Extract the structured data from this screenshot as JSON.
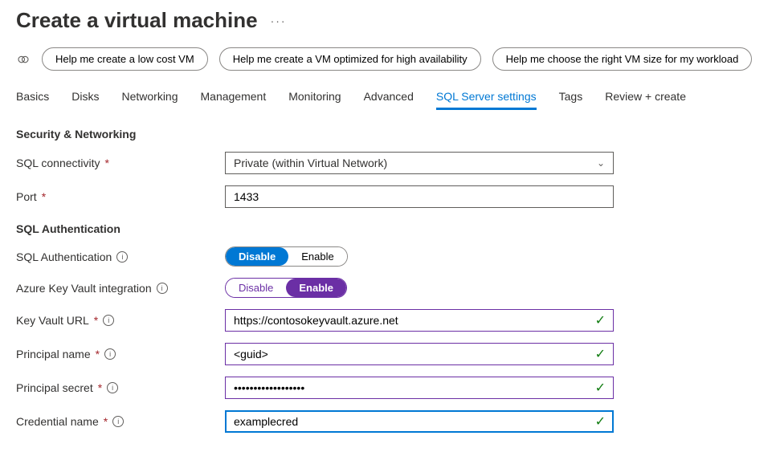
{
  "page": {
    "title": "Create a virtual machine",
    "more": "···"
  },
  "suggestions": {
    "s1": "Help me create a low cost VM",
    "s2": "Help me create a VM optimized for high availability",
    "s3": "Help me choose the right VM size for my workload"
  },
  "tabs": {
    "basics": "Basics",
    "disks": "Disks",
    "networking": "Networking",
    "management": "Management",
    "monitoring": "Monitoring",
    "advanced": "Advanced",
    "sql": "SQL Server settings",
    "tags": "Tags",
    "review": "Review + create"
  },
  "sec1": {
    "title": "Security & Networking"
  },
  "sql_conn": {
    "label": "SQL connectivity",
    "value": "Private (within Virtual Network)"
  },
  "port": {
    "label": "Port",
    "value": "1433"
  },
  "sec2": {
    "title": "SQL Authentication"
  },
  "sql_auth": {
    "label": "SQL Authentication",
    "disable": "Disable",
    "enable": "Enable"
  },
  "akv": {
    "label": "Azure Key Vault integration",
    "disable": "Disable",
    "enable": "Enable"
  },
  "kv_url": {
    "label": "Key Vault URL",
    "value": "https://contosokeyvault.azure.net"
  },
  "p_name": {
    "label": "Principal name",
    "value": "<guid>"
  },
  "p_secret": {
    "label": "Principal secret",
    "value": "••••••••••••••••••"
  },
  "cred": {
    "label": "Credential name",
    "value": "examplecred"
  }
}
